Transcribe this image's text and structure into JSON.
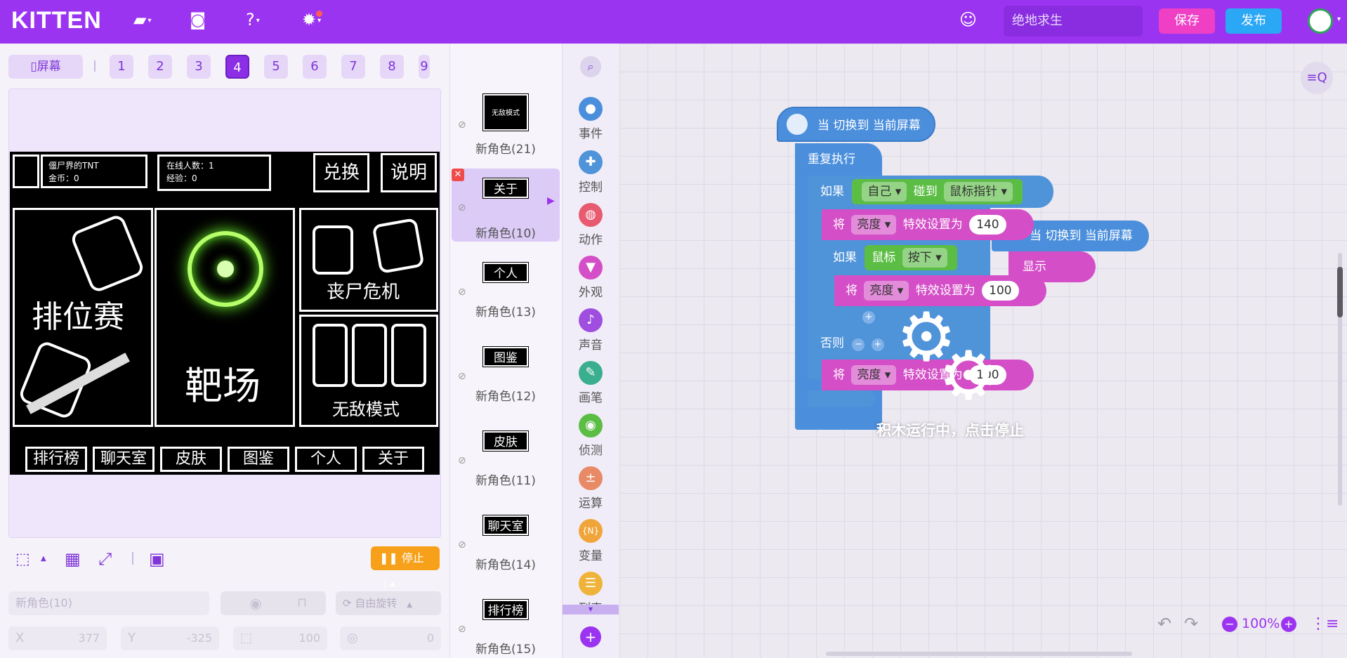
{
  "app": {
    "logo": "KITTEN",
    "project_name": "绝地求生",
    "save_label": "保存",
    "publish_label": "发布"
  },
  "colors": {
    "accent": "#9b34f0",
    "save": "#ee3fc5",
    "publish": "#2aa7f5",
    "stop": "#f7a11a",
    "event": "#4b8fdc",
    "control": "#4f93d9",
    "motion": "#e85a6f",
    "looks": "#d44fc7",
    "sensing": "#5cbd45"
  },
  "toolbar_icons": [
    "folder-icon",
    "backpack-icon",
    "help-icon",
    "settings-icon",
    "add-user-icon"
  ],
  "screens": {
    "screen_label": "屏幕",
    "tabs": [
      "1",
      "2",
      "3",
      "4",
      "5",
      "6",
      "7",
      "8",
      "9"
    ],
    "active": "4",
    "add_label": "+"
  },
  "game": {
    "player_name": "僵尸界的TNT",
    "coins": "金币：0",
    "online": "在线人数：1",
    "exp": "经验：0",
    "exchange": "兑换",
    "info": "说明",
    "ranked": "排位赛",
    "range": "靶场",
    "zombie": "丧尸危机",
    "invincible": "无敌模式",
    "bottom_buttons": [
      "排行榜",
      "聊天室",
      "皮肤",
      "图鉴",
      "个人",
      "关于"
    ]
  },
  "stage_controls": {
    "stop_label": "停止"
  },
  "sprite_props": {
    "name_placeholder": "新角色(10)",
    "rotation": "自由旋转",
    "x_label": "X",
    "x_value": "377",
    "y_label": "Y",
    "y_value": "-325",
    "size_value": "100",
    "dir_value": "0"
  },
  "sprites": [
    {
      "thumb": "无敌模式",
      "name": "新角色(21)"
    },
    {
      "thumb": "关于",
      "name": "新角色(10)",
      "selected": true
    },
    {
      "thumb": "个人",
      "name": "新角色(13)"
    },
    {
      "thumb": "图鉴",
      "name": "新角色(12)"
    },
    {
      "thumb": "皮肤",
      "name": "新角色(11)"
    },
    {
      "thumb": "聊天室",
      "name": "新角色(14)"
    },
    {
      "thumb": "排行榜",
      "name": "新角色(15)"
    }
  ],
  "categories": [
    {
      "label": "事件",
      "color": "#4b8fdc",
      "icon": "event-icon"
    },
    {
      "label": "控制",
      "color": "#4f93d9",
      "icon": "control-icon"
    },
    {
      "label": "动作",
      "color": "#e85a6f",
      "icon": "motion-icon"
    },
    {
      "label": "外观",
      "color": "#d44fc7",
      "icon": "looks-icon"
    },
    {
      "label": "声音",
      "color": "#a04ee0",
      "icon": "sound-icon"
    },
    {
      "label": "画笔",
      "color": "#3aae8e",
      "icon": "pen-icon"
    },
    {
      "label": "侦测",
      "color": "#5cbd45",
      "icon": "sensing-icon"
    },
    {
      "label": "运算",
      "color": "#e98a67",
      "icon": "operator-icon"
    },
    {
      "label": "变量",
      "color": "#f0a53a",
      "icon": "variable-icon"
    },
    {
      "label": "列表",
      "color": "#f0b33a",
      "icon": "list-icon"
    }
  ],
  "blocks": {
    "hat1": "当 切换到 当前屏幕",
    "repeat": "重复执行",
    "if1": "如果",
    "self": "自己",
    "touch": "碰到",
    "mouse_ptr": "鼠标指针",
    "set1": "将",
    "brightness": "亮度",
    "effect_set": "特效设置为",
    "val140": "140",
    "if2": "如果",
    "mouse": "鼠标",
    "pressed": "按下",
    "val100": "100",
    "else": "否则",
    "val100b": "100",
    "hat2": "当 切换到 当前屏幕",
    "show": "显示"
  },
  "overlay": {
    "running_text": "积木运行中，点击停止"
  },
  "zoom": {
    "level": "100%"
  }
}
